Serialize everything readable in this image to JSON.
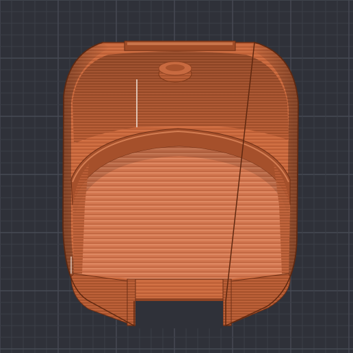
{
  "viewport": {
    "background_color": "#2f3139",
    "grid_minor_color": "#3b3e47",
    "grid_major_color": "#474a54"
  },
  "model": {
    "filament_color": "#c8673b",
    "highlight_color": "#e08a5e",
    "shadow_color": "#8f4322",
    "edge_color": "#6d2f15"
  }
}
